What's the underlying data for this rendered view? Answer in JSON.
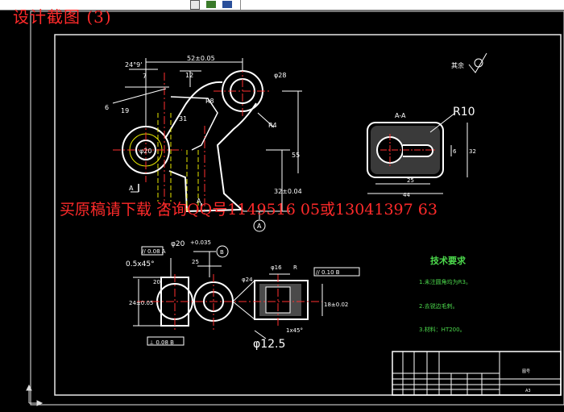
{
  "window": {
    "title": "设计截图 (3)",
    "toolbar_icons": [
      "dropdown-arrow-icon",
      "layer-icon",
      "layer-stack-icon"
    ]
  },
  "watermark": "买原稿请下载 咨询QQ号1149516 05或13041397 63",
  "drawing": {
    "main_view": {
      "dim_top": "52±0.05",
      "dim_angle": "24°9'",
      "dim_7": "7",
      "dim_12": "12",
      "dim_phi28": "φ28",
      "dim_19": "19",
      "dim_6": "6",
      "dim_31": "31",
      "dim_R8": "R8",
      "dim_R4": "R4",
      "dim_55": "55",
      "dim_32": "32±0.04",
      "dim_phi20": "φ20",
      "section_arrow_left": "A",
      "section_arrow_right": "A",
      "datum": "A"
    },
    "section_view": {
      "label": "A-A",
      "radius": "R10",
      "dim_6": "6",
      "dim_32": "32",
      "dim_25": "25",
      "dim_44": "44"
    },
    "surface_note": "其余",
    "bottom_view": {
      "tolerance_left": "// 0.08 A",
      "dim_phi20": "φ20",
      "dim_tol": "+0.035",
      "chamfer1": "0.5x45°",
      "dim_25": "25",
      "dim_20": "20",
      "dim_24": "24±0.05",
      "dim_phi24": "φ24",
      "chamfer2": "1x45°",
      "dim_phi12": "φ12.5",
      "tolerance_bottom": "⊥ 0.08 B",
      "datum": "B"
    },
    "right_view": {
      "dim_phi16": "φ16",
      "dim_R": "R",
      "tolerance": "// 0.10 B",
      "dim_18": "18±0.02"
    },
    "tech_requirements": {
      "heading": "技术要求",
      "items": [
        "1.未注圆角均为R3。",
        "2.去锐边毛刺。",
        "3.材料：HT200。"
      ]
    },
    "title_block": {
      "cell_a": "图号",
      "cell_b": "A3"
    }
  }
}
